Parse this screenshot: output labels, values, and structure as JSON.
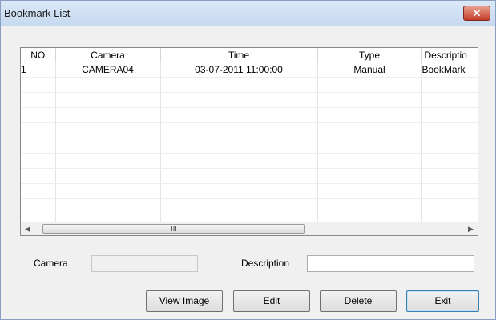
{
  "window": {
    "title": "Bookmark List",
    "close_glyph": "✕"
  },
  "list": {
    "columns": [
      "NO",
      "Camera",
      "Time",
      "Type",
      "Descriptio"
    ],
    "rows": [
      [
        "1",
        "CAMERA04",
        "03-07-2011 11:00:00",
        "Manual",
        "BookMark"
      ],
      [
        "",
        "",
        "",
        "",
        ""
      ],
      [
        "",
        "",
        "",
        "",
        ""
      ],
      [
        "",
        "",
        "",
        "",
        ""
      ],
      [
        "",
        "",
        "",
        "",
        ""
      ],
      [
        "",
        "",
        "",
        "",
        ""
      ],
      [
        "",
        "",
        "",
        "",
        ""
      ],
      [
        "",
        "",
        "",
        "",
        ""
      ],
      [
        "",
        "",
        "",
        "",
        ""
      ],
      [
        "",
        "",
        "",
        "",
        ""
      ],
      [
        "",
        "",
        "",
        "",
        ""
      ]
    ],
    "scrollbar": {
      "left_arrow": "◀",
      "right_arrow": "▶",
      "grip": "III"
    }
  },
  "form": {
    "camera_label": "Camera",
    "camera_value": "",
    "description_label": "Description",
    "description_value": ""
  },
  "buttons": {
    "view_image": "View Image",
    "edit": "Edit",
    "delete": "Delete",
    "exit": "Exit"
  },
  "colors": {
    "title_bar": "#c6d9f0",
    "close_button": "#c43c26",
    "dialog_bg": "#f0f0f0"
  }
}
